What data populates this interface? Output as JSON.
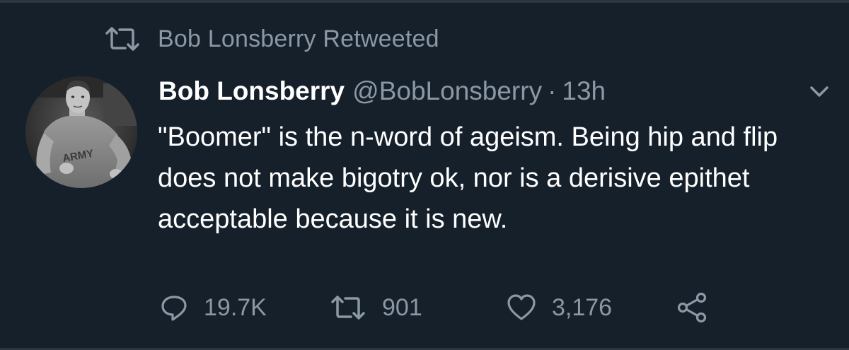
{
  "retweet_context": {
    "text": "Bob Lonsberry Retweeted",
    "icon": "retweet-icon"
  },
  "tweet": {
    "display_name": "Bob Lonsberry",
    "handle": "@BobLonsberry",
    "separator": "·",
    "time": "13h",
    "text": "\"Boomer\" is the n-word of ageism. Being hip and flip does not make bigotry ok, nor is a derisive epithet acceptable because it is new.",
    "avatar": {
      "icon": "avatar-photo",
      "shirt_text": "ARMY"
    },
    "menu_icon": "chevron-down-icon"
  },
  "actions": {
    "reply": {
      "icon": "reply-icon",
      "count": "19.7K"
    },
    "retweet": {
      "icon": "retweet-icon",
      "count": "901"
    },
    "like": {
      "icon": "heart-icon",
      "count": "3,176"
    },
    "share": {
      "icon": "share-icon"
    }
  },
  "colors": {
    "background": "#15202b",
    "primary_text": "#ffffff",
    "secondary_text": "#8b98a5"
  }
}
